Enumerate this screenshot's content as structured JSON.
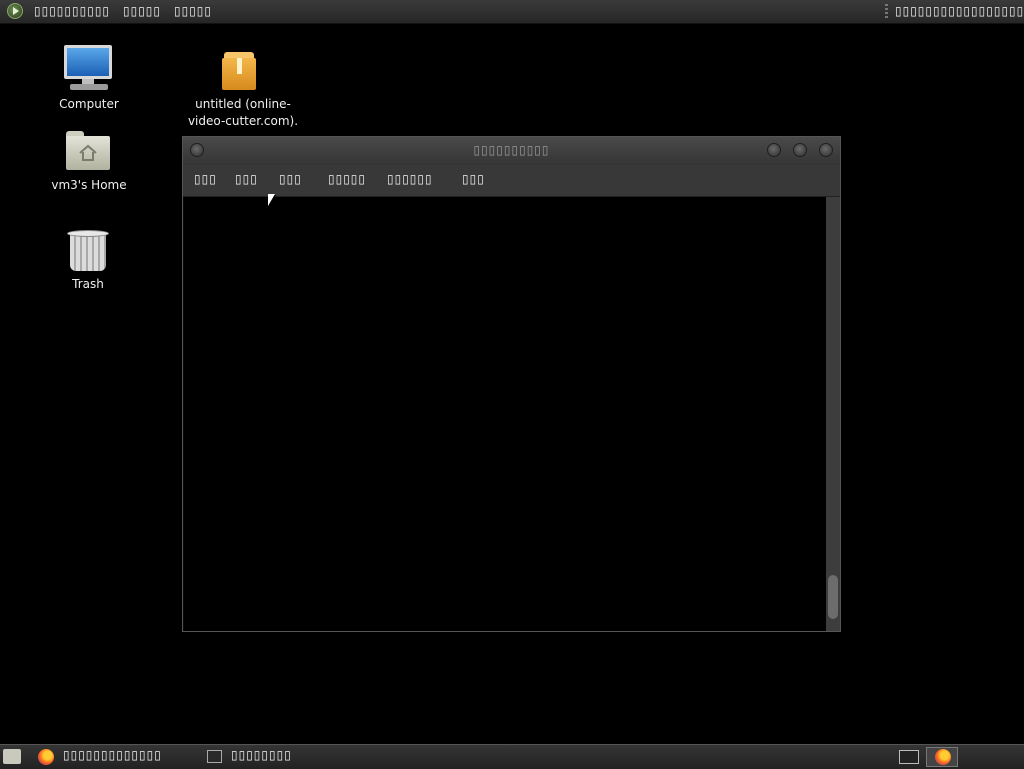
{
  "top_panel": {
    "menu_items": [
      "▯▯▯▯▯▯▯▯▯▯",
      "▯▯▯▯▯",
      "▯▯▯▯▯"
    ],
    "clock": "▯▯▯▯▯▯▯▯▯▯▯▯▯▯▯▯▯▯"
  },
  "desktop": {
    "icons": [
      {
        "label": "Computer"
      },
      {
        "label": "vm3's Home"
      },
      {
        "label": "Trash"
      },
      {
        "label_line1": "untitled (online-",
        "label_line2": "video-cutter.com)."
      }
    ]
  },
  "window": {
    "title": "▯▯▯▯▯▯▯▯▯▯",
    "menu": [
      "▯▯▯",
      "▯▯▯",
      "▯▯▯",
      "▯▯▯▯▯",
      "▯▯▯▯▯▯",
      "▯▯▯"
    ]
  },
  "taskbar": {
    "tasks": [
      {
        "label": "▯▯▯▯▯▯▯▯▯▯▯▯▯",
        "icon": "firefox-icon"
      },
      {
        "label": "▯▯▯▯▯▯▯▯",
        "icon": "terminal-icon"
      }
    ]
  },
  "colors": {
    "desktop_bg": "#000000",
    "panel_bg": "#2e2e2e",
    "window_bg": "#000000"
  }
}
